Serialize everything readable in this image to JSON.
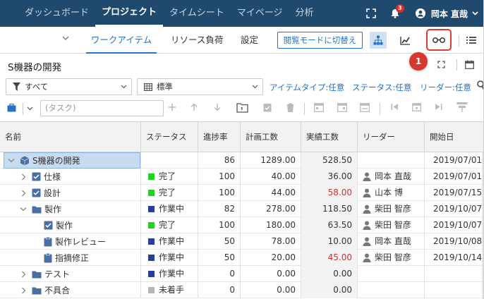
{
  "nav": {
    "items": [
      "ダッシュボード",
      "プロジェクト",
      "タイムシート",
      "マイページ",
      "分析"
    ],
    "active": 1,
    "notification_count": "3",
    "user_name": "岡本 直哉"
  },
  "subnav": {
    "tabs": [
      "ワークアイテム",
      "リソース負荷",
      "設定"
    ],
    "active": 0,
    "browse_button": "閲覧モードに切替え",
    "callout": "1"
  },
  "page": {
    "title": "S機器の開発"
  },
  "filters": {
    "scope": "すべて",
    "view": "標準",
    "links": [
      "アイテムタイプ:任意",
      "ステータス:任意",
      "リーダー:任意"
    ]
  },
  "toolbar": {
    "task_placeholder": "(タスク)"
  },
  "grid": {
    "columns": [
      "名前",
      "ステータス",
      "進捗率",
      "計画工数",
      "実績工数",
      "リーダー",
      "開始日"
    ],
    "rows": [
      {
        "name": "S機器の開発",
        "level": 0,
        "icon": "project-icon",
        "expand": "down",
        "status": "",
        "status_color": "",
        "progress": "86",
        "plan": "1289.00",
        "actual": "528.50",
        "actual_red": false,
        "leader": "",
        "start": "2019/07/01"
      },
      {
        "name": "仕様",
        "level": 1,
        "icon": "checked-task-icon",
        "expand": "right",
        "status": "完了",
        "status_color": "#1fd41f",
        "progress": "100",
        "plan": "40.00",
        "actual": "36.00",
        "actual_red": false,
        "leader": "岡本 直哉",
        "start": "2019/07/01"
      },
      {
        "name": "設計",
        "level": 1,
        "icon": "checked-task-icon",
        "expand": "right",
        "status": "完了",
        "status_color": "#1fd41f",
        "progress": "100",
        "plan": "44.00",
        "actual": "58.00",
        "actual_red": true,
        "leader": "山本 博",
        "start": "2019/07/15"
      },
      {
        "name": "製作",
        "level": 1,
        "icon": "folder-icon",
        "expand": "down",
        "status": "作業中",
        "status_color": "#2b3d9c",
        "progress": "82",
        "plan": "278.00",
        "actual": "118.50",
        "actual_red": false,
        "leader": "柴田 智彦",
        "start": "2019/10/07"
      },
      {
        "name": "製作",
        "level": 2,
        "icon": "checked-task-icon",
        "expand": "",
        "status": "完了",
        "status_color": "#1fd41f",
        "progress": "100",
        "plan": "180.00",
        "actual": "63.50",
        "actual_red": false,
        "leader": "柴田 智彦",
        "start": "2019/10/07"
      },
      {
        "name": "製作レビュー",
        "level": 2,
        "icon": "task-icon",
        "expand": "",
        "status": "作業中",
        "status_color": "#2b3d9c",
        "progress": "50",
        "plan": "78.00",
        "actual": "10.00",
        "actual_red": false,
        "leader": "岡本 直哉",
        "start": "2019/10/08"
      },
      {
        "name": "指摘修正",
        "level": 2,
        "icon": "task-icon",
        "expand": "",
        "status": "作業中",
        "status_color": "#2b3d9c",
        "progress": "50",
        "plan": "20.00",
        "actual": "45.00",
        "actual_red": true,
        "leader": "柴田 智彦",
        "start": "2019/10/14"
      },
      {
        "name": "テスト",
        "level": 1,
        "icon": "folder-icon",
        "expand": "right",
        "status": "作業中",
        "status_color": "#2b3d9c",
        "progress": "0",
        "plan": "0.00",
        "actual": "0.00",
        "actual_red": false,
        "leader": "",
        "start": ""
      },
      {
        "name": "不具合",
        "level": 1,
        "icon": "folder-icon",
        "expand": "right",
        "status": "未着手",
        "status_color": "#b5b5b5",
        "progress": "0",
        "plan": "0.00",
        "actual": "0.00",
        "actual_red": false,
        "leader": "",
        "start": ""
      }
    ]
  },
  "colors": {
    "nav_bg": "#1f4a6e",
    "accent": "#2372c7",
    "icon_blue": "#4a6fa5",
    "highlight": "#e53935"
  }
}
